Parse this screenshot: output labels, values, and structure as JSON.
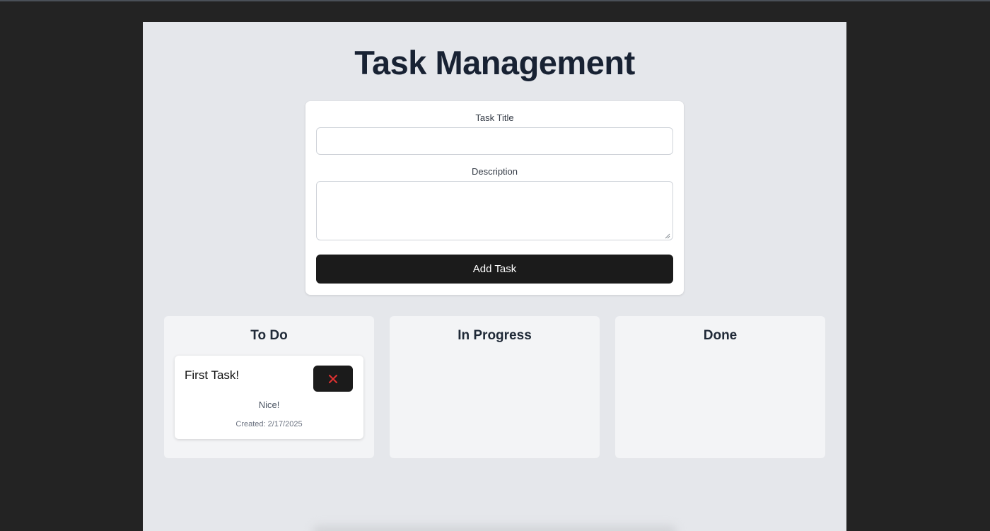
{
  "header": {
    "title": "Task Management"
  },
  "form": {
    "title_label": "Task Title",
    "title_value": "",
    "title_placeholder": "",
    "description_label": "Description",
    "description_value": "",
    "description_placeholder": "",
    "submit_label": "Add Task"
  },
  "columns": [
    {
      "title": "To Do",
      "tasks": [
        {
          "title": "First Task!",
          "description": "Nice!",
          "created": "Created: 2/17/2025",
          "delete_icon": "close-icon"
        }
      ]
    },
    {
      "title": "In Progress",
      "tasks": []
    },
    {
      "title": "Done",
      "tasks": []
    }
  ],
  "colors": {
    "window_bg": "#232323",
    "page_bg": "#e5e7eb",
    "card_bg": "#ffffff",
    "column_bg": "#f3f4f6",
    "button_bg": "#1b1b1b",
    "title_text": "#182233",
    "delete_icon": "#e03131"
  }
}
